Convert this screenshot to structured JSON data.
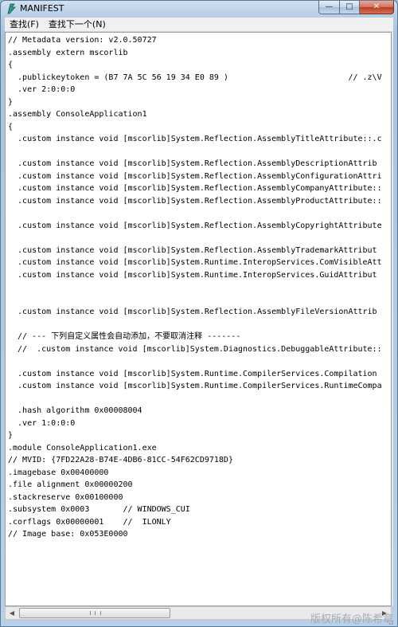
{
  "window": {
    "title": "MANIFEST"
  },
  "menu": {
    "items": [
      "查找(F)",
      "查找下一个(N)"
    ]
  },
  "code_lines": [
    "// Metadata version: v2.0.50727",
    ".assembly extern mscorlib",
    "{",
    "  .publickeytoken = (B7 7A 5C 56 19 34 E0 89 )                         // .z\\V",
    "  .ver 2:0:0:0",
    "}",
    ".assembly ConsoleApplication1",
    "{",
    "  .custom instance void [mscorlib]System.Reflection.AssemblyTitleAttribute::.c",
    "",
    "  .custom instance void [mscorlib]System.Reflection.AssemblyDescriptionAttrib",
    "  .custom instance void [mscorlib]System.Reflection.AssemblyConfigurationAttri",
    "  .custom instance void [mscorlib]System.Reflection.AssemblyCompanyAttribute::",
    "  .custom instance void [mscorlib]System.Reflection.AssemblyProductAttribute::",
    "",
    "  .custom instance void [mscorlib]System.Reflection.AssemblyCopyrightAttribute",
    "",
    "  .custom instance void [mscorlib]System.Reflection.AssemblyTrademarkAttribut",
    "  .custom instance void [mscorlib]System.Runtime.InteropServices.ComVisibleAtt",
    "  .custom instance void [mscorlib]System.Runtime.InteropServices.GuidAttribut",
    "",
    "",
    "  .custom instance void [mscorlib]System.Reflection.AssemblyFileVersionAttrib",
    "",
    "  // --- 下列自定义属性会自动添加，不要取消注释 -------",
    "  //  .custom instance void [mscorlib]System.Diagnostics.DebuggableAttribute::",
    "",
    "  .custom instance void [mscorlib]System.Runtime.CompilerServices.Compilation",
    "  .custom instance void [mscorlib]System.Runtime.CompilerServices.RuntimeCompa",
    "",
    "  .hash algorithm 0x00008004",
    "  .ver 1:0:0:0",
    "}",
    ".module ConsoleApplication1.exe",
    "// MVID: {7FD22A28-B74E-4DB6-81CC-54F62CD9718D}",
    ".imagebase 0x00400000",
    ".file alignment 0x00000200",
    ".stackreserve 0x00100000",
    ".subsystem 0x0003       // WINDOWS_CUI",
    ".corflags 0x00000001    //  ILONLY",
    "// Image base: 0x053E0000"
  ],
  "scrollbar": {
    "left_arrow": "◀",
    "right_arrow": "▶"
  },
  "caption_buttons": {
    "minimize": "—",
    "maximize": "□",
    "close": "✕"
  },
  "watermark": "版权所有@陈希章",
  "colors": {
    "window_frame": "#aac3dd",
    "content_bg": "#ffffff",
    "close_button": "#c7492d"
  }
}
